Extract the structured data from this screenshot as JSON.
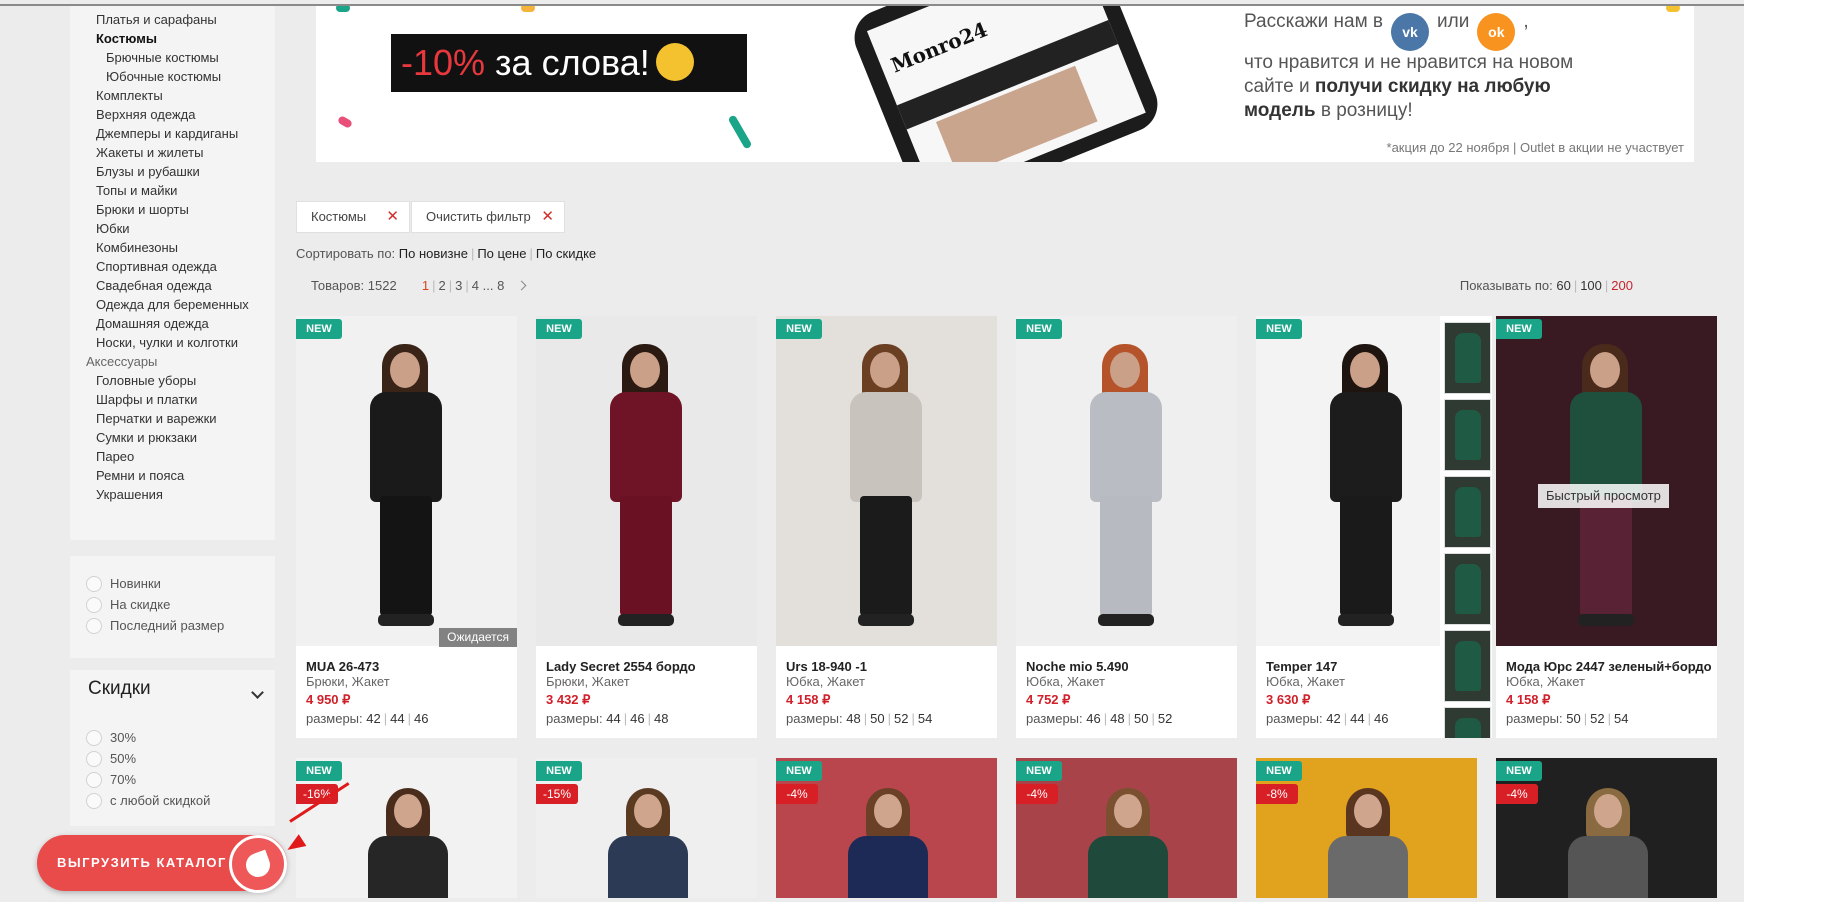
{
  "sidebar": {
    "categories": [
      {
        "label": "Платья и сарафаны",
        "state": "normal"
      },
      {
        "label": "Костюмы",
        "state": "active"
      },
      {
        "label": "Брючные костюмы",
        "state": "sub"
      },
      {
        "label": "Юбочные костюмы",
        "state": "sub"
      },
      {
        "label": "Комплекты",
        "state": "normal"
      },
      {
        "label": "Верхняя одежда",
        "state": "normal"
      },
      {
        "label": "Джемперы и кардиганы",
        "state": "normal"
      },
      {
        "label": "Жакеты и жилеты",
        "state": "normal"
      },
      {
        "label": "Блузы и рубашки",
        "state": "normal"
      },
      {
        "label": "Топы и майки",
        "state": "normal"
      },
      {
        "label": "Брюки и шорты",
        "state": "normal"
      },
      {
        "label": "Юбки",
        "state": "normal"
      },
      {
        "label": "Комбинезоны",
        "state": "normal"
      },
      {
        "label": "Спортивная одежда",
        "state": "normal"
      },
      {
        "label": "Свадебная одежда",
        "state": "normal"
      },
      {
        "label": "Одежда для беременных",
        "state": "normal"
      },
      {
        "label": "Домашняя одежда",
        "state": "normal"
      },
      {
        "label": "Носки, чулки и колготки",
        "state": "normal"
      },
      {
        "label": "Аксессуары",
        "state": "top"
      },
      {
        "label": "Головные уборы",
        "state": "normal"
      },
      {
        "label": "Шарфы и платки",
        "state": "normal"
      },
      {
        "label": "Перчатки и варежки",
        "state": "normal"
      },
      {
        "label": "Сумки и рюкзаки",
        "state": "normal"
      },
      {
        "label": "Парео",
        "state": "normal"
      },
      {
        "label": "Ремни и пояса",
        "state": "normal"
      },
      {
        "label": "Украшения",
        "state": "normal"
      }
    ],
    "filters": [
      "Новинки",
      "На скидке",
      "Последний размер"
    ],
    "discounts": {
      "title": "Скидки",
      "options": [
        "30%",
        "50%",
        "70%",
        "с любой скидкой"
      ]
    }
  },
  "banner": {
    "promo_discount": "-10%",
    "promo_text": " за слова!",
    "line1_a": "Расскажи нам в",
    "line1_b": "или",
    "line1_c": ",",
    "vk": "vk",
    "ok": "ok",
    "line2": "что нравится и не нравится на новом сайте и ",
    "line2_bold": "получи скидку на любую модель",
    "line2_end": " в розницу!",
    "note": "*акция до 22 ноября | Outlet в акции не участвует",
    "phone_logo": "Monro24"
  },
  "active_filters": [
    {
      "label": "Костюмы",
      "remove": "✕"
    },
    {
      "label": "Очистить фильтр",
      "remove": "✕"
    }
  ],
  "sort": {
    "label": "Сортировать по:",
    "options": [
      "По новизне",
      "По цене",
      "По скидке"
    ]
  },
  "pagination": {
    "count_label": "Товаров:",
    "count": "1522",
    "pages": [
      "1",
      "2",
      "3",
      "4",
      "8"
    ],
    "ellipsis": "...",
    "per_page_label": "Показывать по:",
    "per_page": [
      "60",
      "100",
      "200"
    ],
    "per_page_selected": "200"
  },
  "products": [
    {
      "badge": "NEW",
      "name": "MUA 26-473",
      "type": "Брюки, Жакет",
      "price": "4 950 ₽",
      "sizes": [
        "42",
        "44",
        "46"
      ],
      "status": "Ожидается",
      "hair": "#3a2418",
      "body": "#1a1a1a",
      "legs": "#141414",
      "bg": "#f1f1f1"
    },
    {
      "badge": "NEW",
      "name": "Lady Secret 2554 бордо",
      "type": "Брюки, Жакет",
      "price": "3 432 ₽",
      "sizes": [
        "44",
        "46",
        "48"
      ],
      "hair": "#2a1a12",
      "body": "#6e1426",
      "legs": "#6a1224",
      "bg": "#e9e9e9"
    },
    {
      "badge": "NEW",
      "name": "Urs 18-940 -1",
      "type": "Юбка, Жакет",
      "price": "4 158 ₽",
      "sizes": [
        "48",
        "50",
        "52",
        "54"
      ],
      "hair": "#6b3f22",
      "body": "#c9c3bd",
      "legs": "#1b1b1b",
      "bg": "#e3dfdb"
    },
    {
      "badge": "NEW",
      "name": "Noche mio 5.490",
      "type": "Юбка, Жакет",
      "price": "4 752 ₽",
      "sizes": [
        "46",
        "48",
        "50",
        "52"
      ],
      "hair": "#b5532a",
      "body": "#b9bcc2",
      "legs": "#b7bac0",
      "bg": "#efefef"
    },
    {
      "badge": "NEW",
      "name": "Temper 147",
      "type": "Юбка, Жакет",
      "price": "3 630 ₽",
      "sizes": [
        "42",
        "44",
        "46"
      ],
      "hair": "#1e1410",
      "body": "#1c1c1c",
      "legs": "#1a1a1a",
      "bg": "#f3f3f3"
    },
    {
      "badge": "NEW",
      "name": "Мода Юрс 2447 зеленый+бордо",
      "type": "Юбка, Жакет",
      "price": "4 158 ₽",
      "sizes": [
        "50",
        "52",
        "54"
      ],
      "quick": "Быстрый просмотр",
      "hair": "#4a2a1a",
      "body": "#1f4f3d",
      "legs": "#5a2235",
      "bg": "#3a1a22"
    }
  ],
  "products_row2": [
    {
      "badge": "NEW",
      "discount": "-16%",
      "hair": "#4a2c1c",
      "body": "#262626",
      "bg": "#f2f2f2"
    },
    {
      "badge": "NEW",
      "discount": "-15%",
      "hair": "#5b3a22",
      "body": "#2c3a55",
      "bg": "#efefef"
    },
    {
      "badge": "NEW",
      "discount": "-4%",
      "hair": "#6a4026",
      "body": "#1d2a56",
      "bg": "#b9464c"
    },
    {
      "badge": "NEW",
      "discount": "-4%",
      "hair": "#7a5030",
      "body": "#1f4a3b",
      "bg": "#a8434a"
    },
    {
      "badge": "NEW",
      "discount": "-8%",
      "hair": "#5a3520",
      "body": "#6a6a6a",
      "bg": "#e1a21e"
    },
    {
      "badge": "NEW",
      "discount": "-4%",
      "hair": "#8a6a40",
      "body": "#555555",
      "bg": "#202020"
    }
  ],
  "sizes_label": "размеры:",
  "fab": {
    "label": "ВЫГРУЗИТЬ КАТАЛОГ"
  }
}
